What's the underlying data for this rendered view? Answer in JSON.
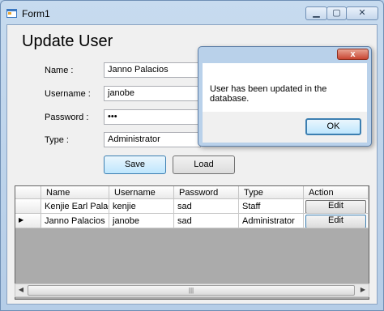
{
  "window": {
    "title": "Form1",
    "minimize_icon": "minimize-icon",
    "maximize_icon": "maximize-icon",
    "close_icon": "close-icon"
  },
  "form": {
    "heading": "Update User",
    "name_label": "Name :",
    "name_value": "Janno Palacios",
    "username_label": "Username :",
    "username_value": "janobe",
    "password_label": "Password :",
    "password_value": "•••",
    "type_label": "Type :",
    "type_value": "Administrator",
    "save_label": "Save",
    "load_label": "Load"
  },
  "grid": {
    "columns": [
      "Name",
      "Username",
      "Password",
      "Type",
      "Action"
    ],
    "rows": [
      {
        "name": "Kenjie Earl Palaci...",
        "username": "kenjie",
        "password": "sad",
        "type": "Staff",
        "action": "Edit",
        "current": false
      },
      {
        "name": "Janno Palacios",
        "username": "janobe",
        "password": "sad",
        "type": "Administrator",
        "action": "Edit",
        "current": true
      }
    ],
    "current_row_marker": "▶",
    "scrollbar_grip": "|||"
  },
  "messagebox": {
    "text": "User has been updated in the database.",
    "ok_label": "OK",
    "close_glyph": "x"
  }
}
